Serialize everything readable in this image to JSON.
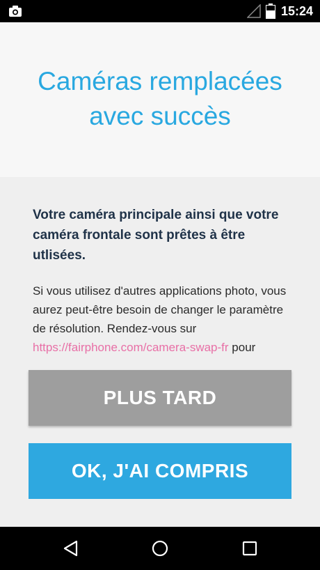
{
  "status_bar": {
    "time": "15:24",
    "icons": [
      "camera-icon",
      "signal-icon",
      "battery-icon"
    ]
  },
  "header": {
    "title_line1": "Caméras remplacées",
    "title_line2": "avec succès"
  },
  "content": {
    "lead": "Votre caméra principale ainsi que votre caméra frontale sont prêtes à être utlisées.",
    "body_before_link": "Si vous utilisez d'autres applications photo, vous aurez peut-être besoin de changer le paramètre de résolution. Rendez-vous sur ",
    "link": "https://fairphone.com/camera-swap-fr",
    "body_after_link": " pour"
  },
  "buttons": {
    "later": "PLUS TARD",
    "ok": "OK, J'AI COMPRIS"
  },
  "colors": {
    "accent": "#29a8e0",
    "link": "#e86fa6",
    "secondary_button": "#9e9e9e",
    "primary_button": "#2ea8e0"
  },
  "nav_bar": {
    "icons": [
      "back-icon",
      "home-icon",
      "recent-apps-icon"
    ]
  }
}
